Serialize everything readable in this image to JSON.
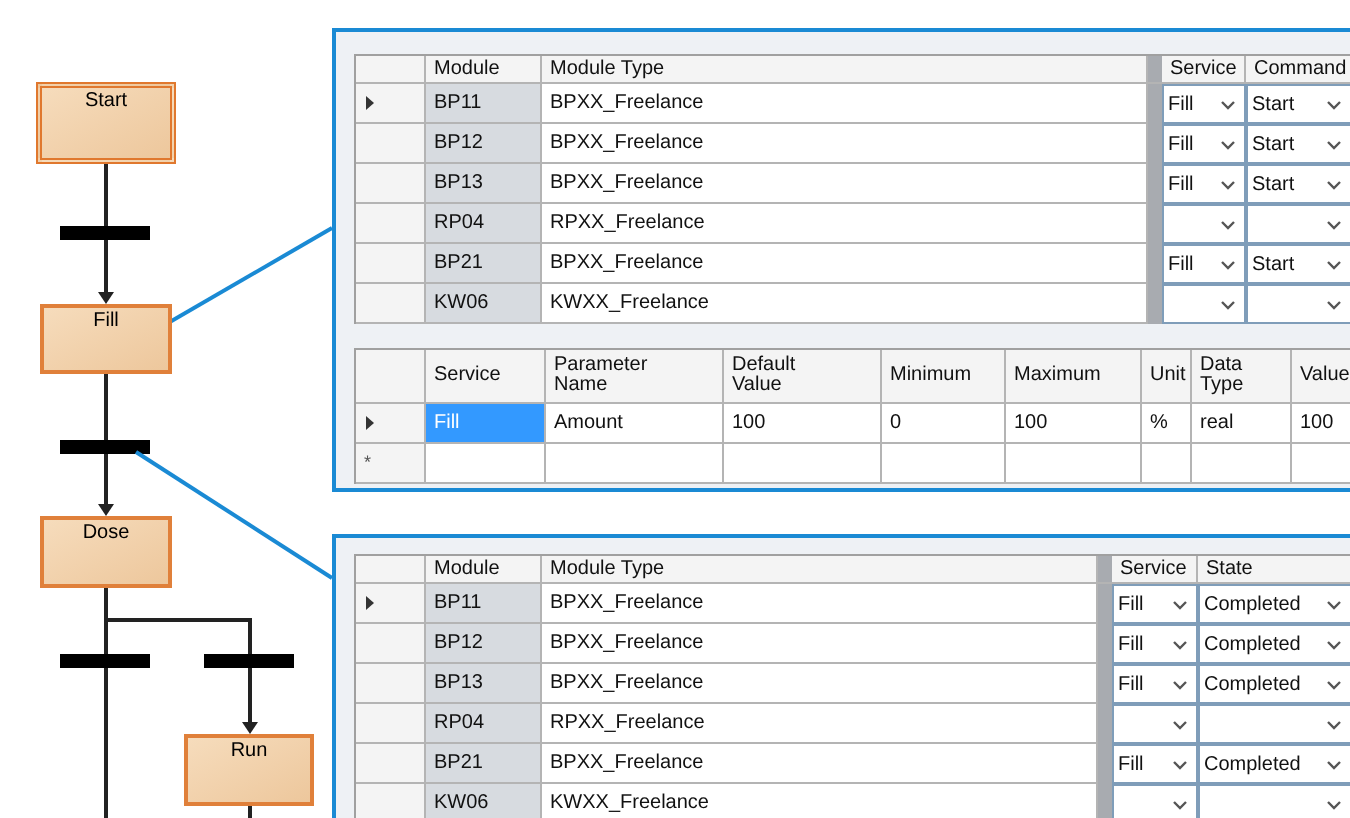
{
  "diagram": {
    "steps": [
      {
        "name": "Start",
        "kind": "initial"
      },
      {
        "name": "Fill",
        "kind": "normal"
      },
      {
        "name": "Dose",
        "kind": "normal"
      },
      {
        "name": "Run",
        "kind": "normal"
      }
    ]
  },
  "command_panel": {
    "modules": {
      "columns": [
        "Module",
        "Module Type",
        "Service",
        "Command"
      ],
      "rows": [
        {
          "selected": true,
          "module": "BP11",
          "module_type": "BPXX_Freelance",
          "service": "Fill",
          "command": "Start"
        },
        {
          "selected": false,
          "module": "BP12",
          "module_type": "BPXX_Freelance",
          "service": "Fill",
          "command": "Start"
        },
        {
          "selected": false,
          "module": "BP13",
          "module_type": "BPXX_Freelance",
          "service": "Fill",
          "command": "Start"
        },
        {
          "selected": false,
          "module": "RP04",
          "module_type": "RPXX_Freelance"
        },
        {
          "selected": false,
          "module": "BP21",
          "module_type": "BPXX_Freelance",
          "service": "Fill",
          "command": "Start"
        },
        {
          "selected": false,
          "module": "KW06",
          "module_type": "KWXX_Freelance"
        }
      ]
    },
    "parameters": {
      "columns": [
        "Service",
        "Parameter Name",
        "Default Value",
        "Minimum",
        "Maximum",
        "Unit",
        "Data Type",
        "Value"
      ],
      "rows": [
        {
          "kind": "data",
          "selected": true,
          "cells": [
            {
              "text": "Fill",
              "selected": true
            },
            {
              "text": "Amount",
              "selected": false
            },
            {
              "text": "100",
              "selected": false
            },
            {
              "text": "0",
              "selected": false
            },
            {
              "text": "100",
              "selected": false
            },
            {
              "text": "%",
              "selected": false
            },
            {
              "text": "real",
              "selected": false
            },
            {
              "text": "100",
              "selected": false
            }
          ]
        },
        {
          "kind": "new",
          "marker": "*"
        }
      ]
    }
  },
  "state_panel": {
    "modules": {
      "columns": [
        "Module",
        "Module Type",
        "Service",
        "State"
      ],
      "rows": [
        {
          "selected": true,
          "module": "BP11",
          "module_type": "BPXX_Freelance",
          "service": "Fill",
          "state": "Completed"
        },
        {
          "selected": false,
          "module": "BP12",
          "module_type": "BPXX_Freelance",
          "service": "Fill",
          "state": "Completed"
        },
        {
          "selected": false,
          "module": "BP13",
          "module_type": "BPXX_Freelance",
          "service": "Fill",
          "state": "Completed"
        },
        {
          "selected": false,
          "module": "RP04",
          "module_type": "RPXX_Freelance"
        },
        {
          "selected": false,
          "module": "BP21",
          "module_type": "BPXX_Freelance",
          "service": "Fill",
          "state": "Completed"
        },
        {
          "selected": false,
          "module": "KW06",
          "module_type": "KWXX_Freelance"
        }
      ]
    }
  }
}
